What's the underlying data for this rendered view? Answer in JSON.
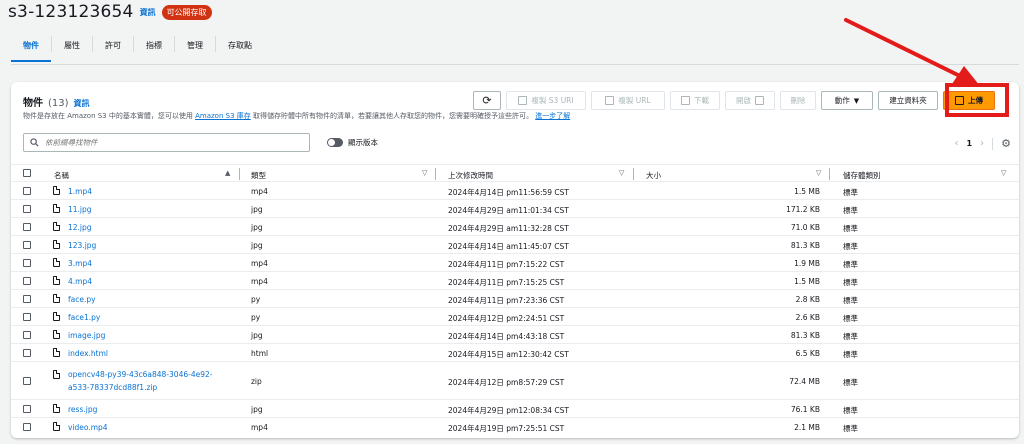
{
  "bucket": {
    "name": "s3-123123654",
    "info_label": "資訊",
    "public_badge": "可公開存取"
  },
  "tabs": [
    {
      "label": "物件",
      "active": true
    },
    {
      "label": "屬性"
    },
    {
      "label": "許可"
    },
    {
      "label": "指標"
    },
    {
      "label": "管理"
    },
    {
      "label": "存取點"
    }
  ],
  "objects_panel": {
    "title": "物件",
    "count": "(13)",
    "info_label": "資訊",
    "description_prefix": "物件是存放在 Amazon S3 中的基本實體，您可以使用",
    "inventory_link": "Amazon S3 庫存",
    "description_mid": "取得儲存貯體中所有物件的清單，若要讓其他人存取您的物件，您需要明確授予這些許可。",
    "learn_more": "進一步了解"
  },
  "toolbar": {
    "copy_s3_uri": "複製 S3 URI",
    "copy_url": "複製 URL",
    "download": "下載",
    "open": "開啟",
    "delete": "刪除",
    "actions": "動作",
    "create_folder": "建立資料夾",
    "upload": "上傳"
  },
  "search": {
    "placeholder": "依前綴尋找物件"
  },
  "show_versions": "顯示版本",
  "pagination": {
    "page": "1"
  },
  "columns": {
    "name": "名稱",
    "type": "類型",
    "modified": "上次修改時間",
    "size": "大小",
    "storage_class": "儲存體類別"
  },
  "rows": [
    {
      "name": "1.mp4",
      "type": "mp4",
      "modified": "2024年4月14日 pm11:56:59 CST",
      "size": "1.5 MB",
      "storage": "標準"
    },
    {
      "name": "11.jpg",
      "type": "jpg",
      "modified": "2024年4月29日 am11:01:34 CST",
      "size": "171.2 KB",
      "storage": "標準"
    },
    {
      "name": "12.jpg",
      "type": "jpg",
      "modified": "2024年4月29日 am11:32:28 CST",
      "size": "71.0 KB",
      "storage": "標準"
    },
    {
      "name": "123.jpg",
      "type": "jpg",
      "modified": "2024年4月14日 am11:45:07 CST",
      "size": "81.3 KB",
      "storage": "標準"
    },
    {
      "name": "3.mp4",
      "type": "mp4",
      "modified": "2024年4月11日 pm7:15:22 CST",
      "size": "1.9 MB",
      "storage": "標準"
    },
    {
      "name": "4.mp4",
      "type": "mp4",
      "modified": "2024年4月11日 pm7:15:25 CST",
      "size": "1.5 MB",
      "storage": "標準"
    },
    {
      "name": "face.py",
      "type": "py",
      "modified": "2024年4月11日 pm7:23:36 CST",
      "size": "2.8 KB",
      "storage": "標準"
    },
    {
      "name": "face1.py",
      "type": "py",
      "modified": "2024年4月12日 pm2:24:51 CST",
      "size": "2.6 KB",
      "storage": "標準"
    },
    {
      "name": "image.jpg",
      "type": "jpg",
      "modified": "2024年4月14日 pm4:43:18 CST",
      "size": "81.3 KB",
      "storage": "標準"
    },
    {
      "name": "index.html",
      "type": "html",
      "modified": "2024年4月15日 am12:30:42 CST",
      "size": "6.5 KB",
      "storage": "標準"
    },
    {
      "name": "opencv48-py39-43c6a848-3046-4e92-",
      "name2": "a533-78337dcd88f1.zip",
      "type": "zip",
      "modified": "2024年4月12日 pm8:57:29 CST",
      "size": "72.4 MB",
      "storage": "標準"
    },
    {
      "name": "ress.jpg",
      "type": "jpg",
      "modified": "2024年4月29日 pm12:08:34 CST",
      "size": "76.1 KB",
      "storage": "標準"
    },
    {
      "name": "video.mp4",
      "type": "mp4",
      "modified": "2024年4月19日 pm7:25:51 CST",
      "size": "2.1 MB",
      "storage": "標準"
    }
  ],
  "colors": {
    "accent": "#0972d3",
    "upload": "#ff9900",
    "annotation": "#e31b1b",
    "public_badge": "#d13212"
  }
}
